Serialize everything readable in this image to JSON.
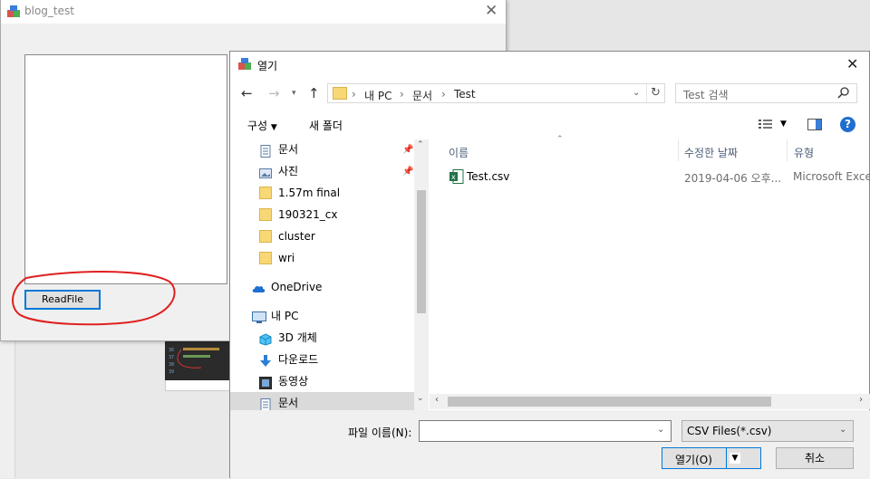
{
  "bg_window": {
    "title": "blog_test",
    "readfile_label": "ReadFile"
  },
  "dialog": {
    "title": "열기",
    "breadcrumbs": [
      "내 PC",
      "문서",
      "Test"
    ],
    "search_placeholder": "Test 검색",
    "toolbar": {
      "organize": "구성",
      "new_folder": "새 폴더"
    },
    "nav": [
      {
        "label": "문서",
        "icon": "document-icon",
        "pinned": true
      },
      {
        "label": "사진",
        "icon": "picture-icon",
        "pinned": true
      },
      {
        "label": "1.57m final",
        "icon": "folder-icon"
      },
      {
        "label": "190321_cx",
        "icon": "folder-icon"
      },
      {
        "label": "cluster",
        "icon": "folder-icon"
      },
      {
        "label": "wri",
        "icon": "folder-icon"
      },
      {
        "label": "OneDrive",
        "icon": "cloud-icon"
      },
      {
        "label": "내 PC",
        "icon": "computer-icon"
      },
      {
        "label": "3D 개체",
        "icon": "cube-icon"
      },
      {
        "label": "다운로드",
        "icon": "download-icon"
      },
      {
        "label": "동영상",
        "icon": "video-icon"
      },
      {
        "label": "문서",
        "icon": "document-icon",
        "selected": true
      }
    ],
    "columns": {
      "name": "이름",
      "date": "수정한 날짜",
      "type": "유형"
    },
    "files": [
      {
        "name": "Test.csv",
        "date": "2019-04-06 오후...",
        "type": "Microsoft Excel"
      }
    ],
    "filename_label": "파일 이름(N):",
    "filename_value": "",
    "filter": "CSV Files(*.csv)",
    "open_label": "열기(O)",
    "cancel_label": "취소"
  },
  "colors": {
    "accent": "#0078d7",
    "annotation": "#e02020",
    "folder": "#f8d775"
  }
}
